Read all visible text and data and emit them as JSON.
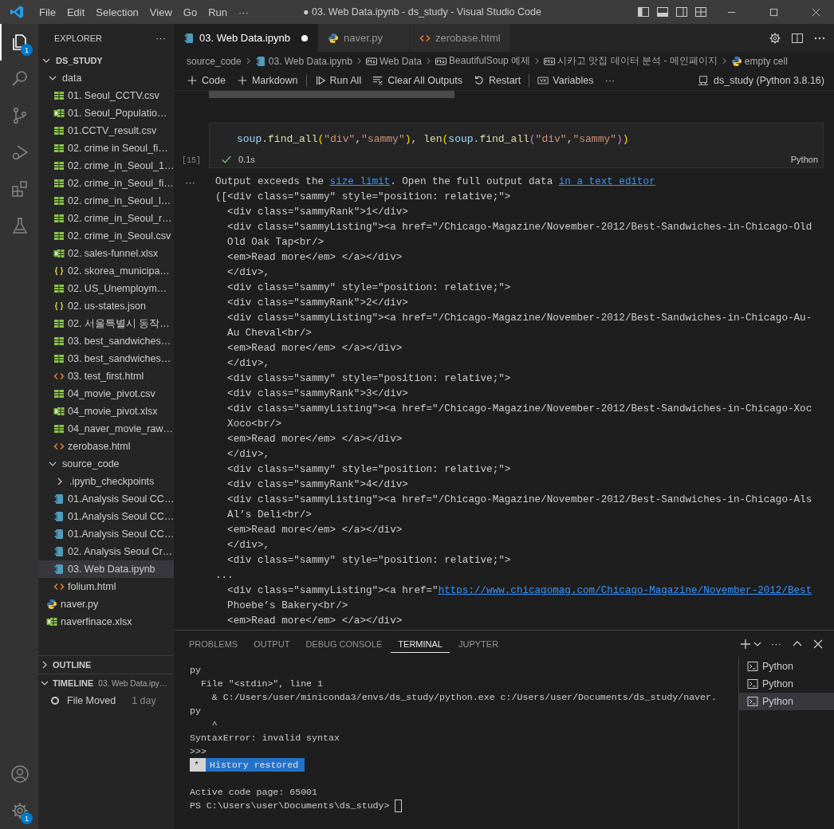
{
  "title_bar": {
    "menu": [
      "File",
      "Edit",
      "Selection",
      "View",
      "Go",
      "Run",
      "···"
    ],
    "title": "● 03. Web Data.ipynb - ds_study - Visual Studio Code"
  },
  "activity_bar": {
    "items": [
      {
        "kind": "explorer",
        "selected": true,
        "badge": "1"
      },
      {
        "kind": "search",
        "selected": false
      },
      {
        "kind": "source-control",
        "selected": false
      },
      {
        "kind": "run-debug",
        "selected": false
      },
      {
        "kind": "extensions",
        "selected": false
      },
      {
        "kind": "testing",
        "selected": false
      }
    ],
    "bottom": [
      {
        "kind": "account"
      },
      {
        "kind": "manage",
        "badge": "1"
      }
    ]
  },
  "sidebar": {
    "title": "EXPLORER",
    "more": "···",
    "root": {
      "label": "DS_STUDY",
      "expanded": true
    },
    "tree": [
      {
        "label": "data",
        "kind": "folder",
        "expanded": true,
        "selected": false,
        "children": [
          {
            "label": "01. Seoul_CCTV.csv",
            "kind": "csv",
            "selected": false
          },
          {
            "label": "01. Seoul_Populatio…",
            "kind": "xlsx",
            "selected": false
          },
          {
            "label": "01.CCTV_result.csv",
            "kind": "csv",
            "selected": false
          },
          {
            "label": "02. crime in Seoul_fi…",
            "kind": "csv",
            "selected": false
          },
          {
            "label": "02. crime_in_Seoul_1…",
            "kind": "csv",
            "selected": false
          },
          {
            "label": "02. crime_in_Seoul_fi…",
            "kind": "csv",
            "selected": false
          },
          {
            "label": "02. crime_in_Seoul_l…",
            "kind": "csv",
            "selected": false
          },
          {
            "label": "02. crime_in_Seoul_r…",
            "kind": "csv",
            "selected": false
          },
          {
            "label": "02. crime_in_Seoul.csv",
            "kind": "csv",
            "selected": false
          },
          {
            "label": "02. sales-funnel.xlsx",
            "kind": "xlsx",
            "selected": false
          },
          {
            "label": "02. skorea_municipa…",
            "kind": "json",
            "selected": false
          },
          {
            "label": "02. US_Unemploym…",
            "kind": "csv",
            "selected": false
          },
          {
            "label": "02. us-states.json",
            "kind": "json",
            "selected": false
          },
          {
            "label": "02. 서울특별시 동작…",
            "kind": "csv",
            "selected": false
          },
          {
            "label": "03. best_sandwiches…",
            "kind": "csv",
            "selected": false
          },
          {
            "label": "03. best_sandwiches…",
            "kind": "csv",
            "selected": false
          },
          {
            "label": "03. test_first.html",
            "kind": "html",
            "selected": false
          },
          {
            "label": "04_movie_pivot.csv",
            "kind": "csv",
            "selected": false
          },
          {
            "label": "04_movie_pivot.xlsx",
            "kind": "xlsx",
            "selected": false
          },
          {
            "label": "04_naver_movie_raw…",
            "kind": "csv",
            "selected": false
          },
          {
            "label": "zerobase.html",
            "kind": "html",
            "selected": false
          }
        ]
      },
      {
        "label": "source_code",
        "kind": "folder",
        "expanded": true,
        "selected": false,
        "children": [
          {
            "label": ".ipynb_checkpoints",
            "kind": "folder",
            "expanded": false,
            "selected": false
          },
          {
            "label": "01.Analysis Seoul CC…",
            "kind": "notebook",
            "selected": false
          },
          {
            "label": "01.Analysis Seoul CC…",
            "kind": "notebook",
            "selected": false
          },
          {
            "label": "01.Analysis Seoul CC…",
            "kind": "notebook",
            "selected": false
          },
          {
            "label": "02. Analysis Seoul Cr…",
            "kind": "notebook",
            "selected": false
          },
          {
            "label": "03. Web Data.ipynb",
            "kind": "notebook",
            "selected": true
          },
          {
            "label": "folium.html",
            "kind": "html",
            "selected": false
          }
        ]
      },
      {
        "label": "naver.py",
        "kind": "python",
        "selected": false
      },
      {
        "label": "naverfinace.xlsx",
        "kind": "xlsx",
        "selected": false
      }
    ],
    "outline": {
      "label": "OUTLINE",
      "expanded": false
    },
    "timeline": {
      "label": "TIMELINE",
      "file": "03. Web Data.ipy…",
      "expanded": true,
      "entries": [
        {
          "label": "File Moved",
          "time": "1 day"
        }
      ]
    }
  },
  "tabs": [
    {
      "label": "03. Web Data.ipynb",
      "kind": "notebook",
      "selected": true,
      "dirty": true
    },
    {
      "label": "naver.py",
      "kind": "python",
      "selected": false,
      "dirty": false
    },
    {
      "label": "zerobase.html",
      "kind": "html",
      "selected": false,
      "dirty": false
    }
  ],
  "breadcrumb": [
    {
      "label": "source_code",
      "kind": "folder"
    },
    {
      "label": "03. Web Data.ipynb",
      "kind": "notebook"
    },
    {
      "label": "Web Data",
      "kind": "markdown"
    },
    {
      "label": "BeautifulSoup 예제",
      "kind": "markdown"
    },
    {
      "label": "시카고 맛집 데이터 분석 - 메인페이지",
      "kind": "markdown"
    },
    {
      "label": "empty cell",
      "kind": "python"
    }
  ],
  "notebook_toolbar": {
    "items": [
      {
        "label": "Code",
        "kind": "add"
      },
      {
        "label": "Markdown",
        "kind": "add"
      },
      {
        "label": "Run All",
        "kind": "run"
      },
      {
        "label": "Clear All Outputs",
        "kind": "clear"
      },
      {
        "label": "Restart",
        "kind": "restart"
      },
      {
        "label": "Variables",
        "kind": "variables"
      }
    ],
    "more": "···",
    "kernel": "ds_study (Python 3.8.16)"
  },
  "cell": {
    "execution_count": "[15]",
    "code": [
      {
        "text": "soup",
        "kind": "var"
      },
      {
        "text": ".",
        "kind": "punct"
      },
      {
        "text": "find_all",
        "kind": "fn"
      },
      {
        "text": "(",
        "kind": "br1"
      },
      {
        "text": "\"div\"",
        "kind": "str"
      },
      {
        "text": ",",
        "kind": "punct"
      },
      {
        "text": "\"sammy\"",
        "kind": "str"
      },
      {
        "text": ")",
        "kind": "br1"
      },
      {
        "text": ", ",
        "kind": "punct"
      },
      {
        "text": "len",
        "kind": "fn"
      },
      {
        "text": "(",
        "kind": "br1"
      },
      {
        "text": "soup",
        "kind": "var"
      },
      {
        "text": ".",
        "kind": "punct"
      },
      {
        "text": "find_all",
        "kind": "fn"
      },
      {
        "text": "(",
        "kind": "br2"
      },
      {
        "text": "\"div\"",
        "kind": "str"
      },
      {
        "text": ",",
        "kind": "punct"
      },
      {
        "text": "\"sammy\"",
        "kind": "str"
      },
      {
        "text": ")",
        "kind": "br2"
      },
      {
        "text": ")",
        "kind": "br1"
      }
    ],
    "status": "0.1s",
    "language": "Python",
    "output_more": "···",
    "notice": [
      {
        "text": "Output exceeds the ",
        "kind": "text"
      },
      {
        "text": "size limit",
        "kind": "link"
      },
      {
        "text": ". Open the full output data ",
        "kind": "text"
      },
      {
        "text": "in a text editor",
        "kind": "link"
      }
    ],
    "output": [
      {
        "text": "([<div class=\"sammy\" style=\"position: relative;\">"
      },
      {
        "text": "  <div class=\"sammyRank\">1</div>"
      },
      {
        "text": "  <div class=\"sammyListing\"><a href=\"/Chicago-Magazine/November-2012/Best-Sandwiches-in-Chicago-Old"
      },
      {
        "text": "  Old Oak Tap<br/>"
      },
      {
        "text": "  <em>Read more</em> </a></div>"
      },
      {
        "text": "  </div>,"
      },
      {
        "text": "  <div class=\"sammy\" style=\"position: relative;\">"
      },
      {
        "text": "  <div class=\"sammyRank\">2</div>"
      },
      {
        "text": "  <div class=\"sammyListing\"><a href=\"/Chicago-Magazine/November-2012/Best-Sandwiches-in-Chicago-Au-"
      },
      {
        "text": "  Au Cheval<br/>"
      },
      {
        "text": "  <em>Read more</em> </a></div>"
      },
      {
        "text": "  </div>,"
      },
      {
        "text": "  <div class=\"sammy\" style=\"position: relative;\">"
      },
      {
        "text": "  <div class=\"sammyRank\">3</div>"
      },
      {
        "text": "  <div class=\"sammyListing\"><a href=\"/Chicago-Magazine/November-2012/Best-Sandwiches-in-Chicago-Xoc"
      },
      {
        "text": "  Xoco<br/>"
      },
      {
        "text": "  <em>Read more</em> </a></div>"
      },
      {
        "text": "  </div>,"
      },
      {
        "text": "  <div class=\"sammy\" style=\"position: relative;\">"
      },
      {
        "text": "  <div class=\"sammyRank\">4</div>"
      },
      {
        "text": "  <div class=\"sammyListing\"><a href=\"/Chicago-Magazine/November-2012/Best-Sandwiches-in-Chicago-Als"
      },
      {
        "text": "  Al’s Deli<br/>"
      },
      {
        "text": "  <em>Read more</em> </a></div>"
      },
      {
        "text": "  </div>,"
      },
      {
        "text": "  <div class=\"sammy\" style=\"position: relative;\">"
      },
      {
        "text": "..."
      },
      {
        "text": "  <div class=\"sammyListing\"><a href=\"",
        "link": "https://www.chicagomag.com/Chicago-Magazine/November-2012/Best"
      },
      {
        "text": "  Phoebe’s Bakery<br/>"
      },
      {
        "text": "  <em>Read more</em> </a></div>"
      }
    ]
  },
  "panel": {
    "tabs": [
      {
        "label": "PROBLEMS",
        "selected": false
      },
      {
        "label": "OUTPUT",
        "selected": false
      },
      {
        "label": "DEBUG CONSOLE",
        "selected": false
      },
      {
        "label": "TERMINAL",
        "selected": true
      },
      {
        "label": "JUPYTER",
        "selected": false
      }
    ],
    "more": "···",
    "terminal": [
      {
        "kind": "text",
        "text": "py"
      },
      {
        "kind": "text",
        "text": "  File \"<stdin>\", line 1"
      },
      {
        "kind": "text",
        "text": "    & C:/Users/user/miniconda3/envs/ds_study/python.exe c:/Users/user/Documents/ds_study/naver."
      },
      {
        "kind": "text",
        "text": "py"
      },
      {
        "kind": "text",
        "text": "    ^"
      },
      {
        "kind": "text",
        "text": "SyntaxError: invalid syntax"
      },
      {
        "kind": "text",
        "text": ">>>"
      },
      {
        "kind": "badge",
        "marker": "*",
        "text": "History restored"
      },
      {
        "kind": "text",
        "text": "Active code page: 65001",
        "gap_before": true
      },
      {
        "kind": "prompt",
        "text": "PS C:\\Users\\user\\Documents\\ds_study> "
      }
    ],
    "terminals": [
      {
        "label": "Python",
        "selected": false
      },
      {
        "label": "Python",
        "selected": false
      },
      {
        "label": "Python",
        "selected": true
      }
    ]
  }
}
